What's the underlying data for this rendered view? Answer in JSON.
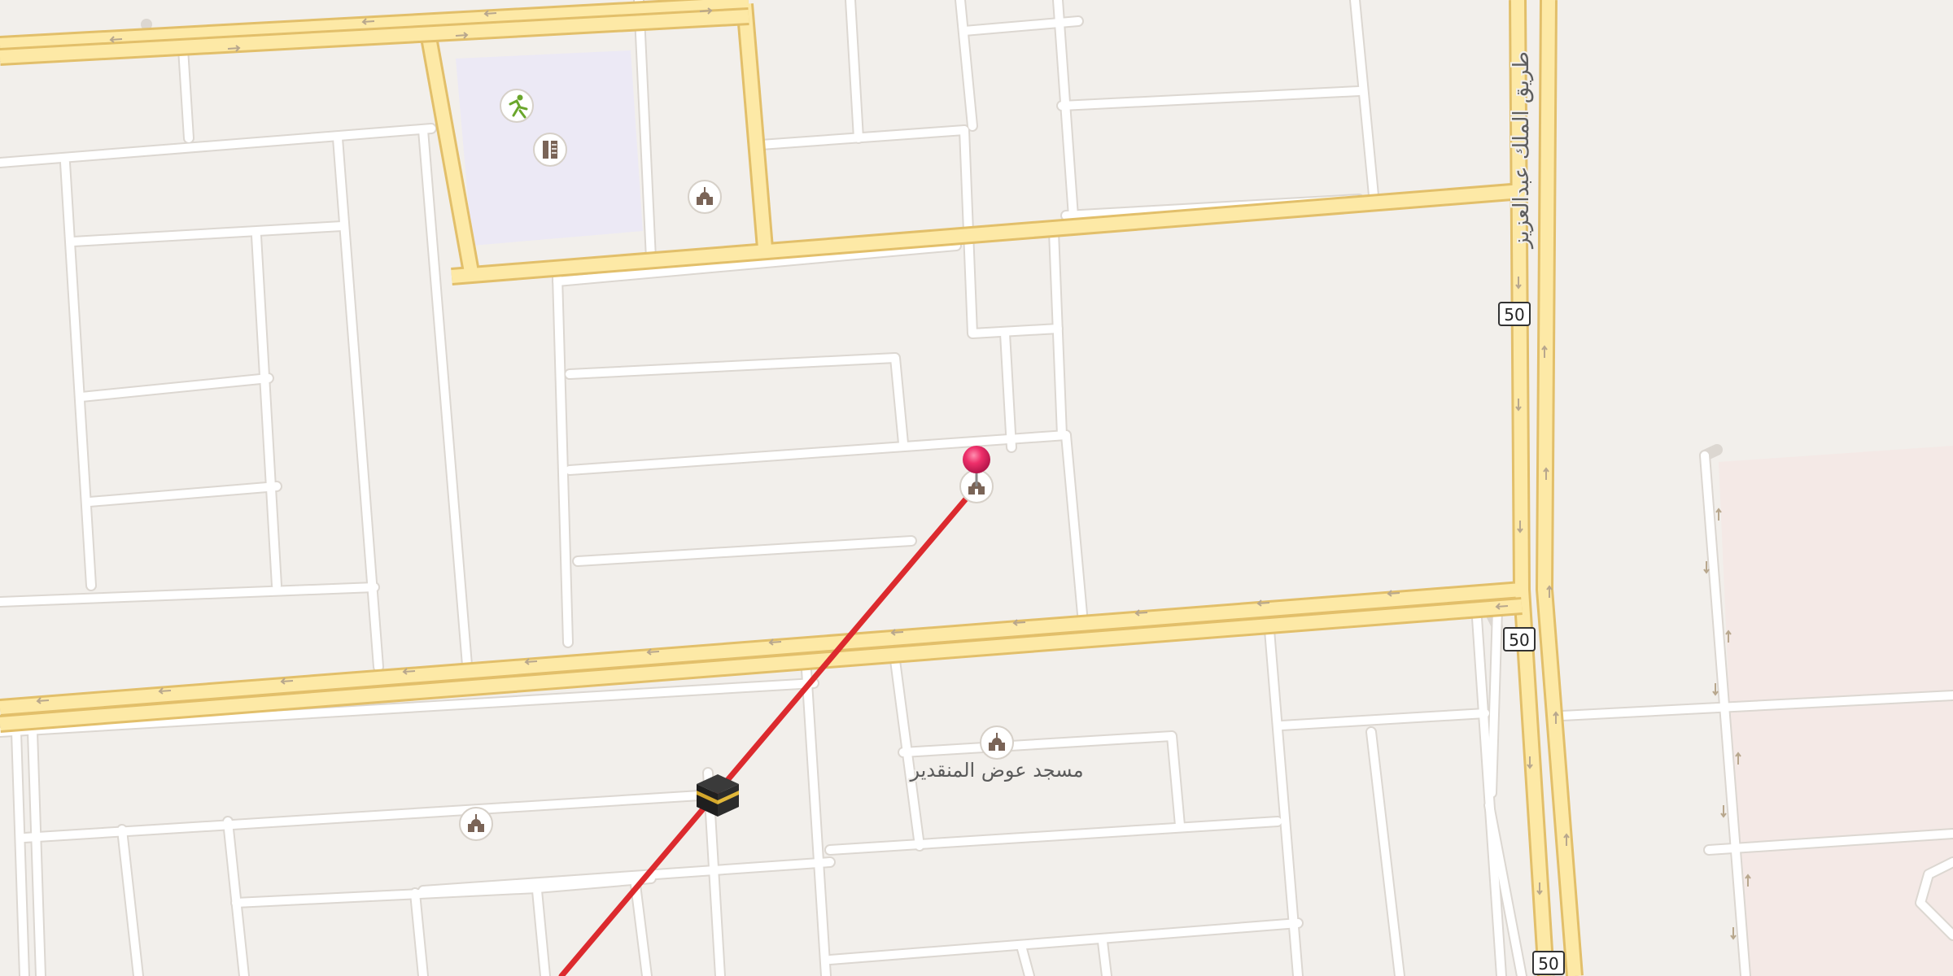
{
  "map": {
    "colors": {
      "land": "#f2efeb",
      "block": "#f2efeb",
      "street": "#ffffff",
      "street_casing": "#dcd7d1",
      "major_road": "#fde9a6",
      "major_road_casing": "#e6c46d",
      "park": "#ece9f5",
      "pink_area": "#f3e7e4",
      "route_line": "#dc2a2e",
      "pin": "#e8235f",
      "poi_ring": "#ffffff",
      "poi_icon": "#7a6457",
      "arrow": "#b9a98f"
    },
    "street_label": "طريق الملك عبدالعزيز",
    "mosque_label": "مسجد عوض المنقدير",
    "road_shields": [
      {
        "id": "50",
        "label": "50"
      },
      {
        "id": "50b",
        "label": "50"
      },
      {
        "id": "50c",
        "label": "50"
      }
    ],
    "pois": [
      {
        "name": "sports-icon",
        "kind": "sports"
      },
      {
        "name": "school-icon",
        "kind": "school"
      },
      {
        "name": "mosque-icon",
        "kind": "mosque"
      },
      {
        "name": "mosque-icon",
        "kind": "mosque"
      },
      {
        "name": "mosque-icon",
        "kind": "mosque"
      },
      {
        "name": "kaaba-icon",
        "kind": "kaaba"
      }
    ],
    "pin": {
      "name": "location-pin",
      "color": "#e8235f"
    }
  }
}
